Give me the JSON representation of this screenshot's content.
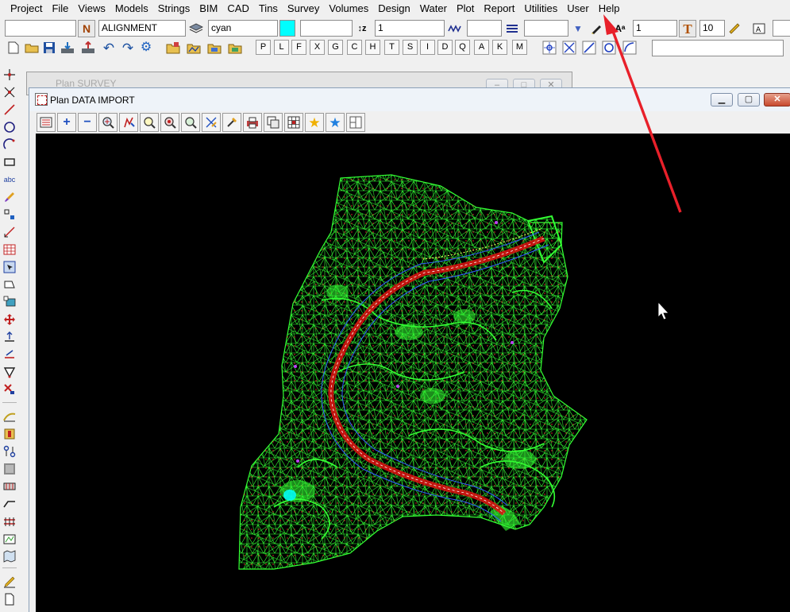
{
  "menu": [
    "Project",
    "File",
    "Views",
    "Models",
    "Strings",
    "BIM",
    "CAD",
    "Tins",
    "Survey",
    "Volumes",
    "Design",
    "Water",
    "Plot",
    "Report",
    "Utilities",
    "User",
    "Help"
  ],
  "toolbar": {
    "model_field": "",
    "string_name": "ALIGNMENT",
    "colour_name": "cyan",
    "colour_swatch": "#00ffff",
    "height_field": "",
    "linestyle_value": "1",
    "weight_field": "",
    "pattern_field": "",
    "text_size": "1",
    "text_width": "10",
    "far_right_field": ""
  },
  "snap_letters": [
    "P",
    "L",
    "F",
    "X",
    "G",
    "C",
    "H",
    "T",
    "S",
    "I",
    "D",
    "Q",
    "A",
    "K",
    "M"
  ],
  "background_window": {
    "title": "Plan SURVEY"
  },
  "window": {
    "title": "Plan DATA IMPORT"
  },
  "colors": {
    "mesh": "#33ff33",
    "alignment": "#e01010",
    "canvas_bg": "#000000",
    "annotation_arrow": "#e8202a"
  }
}
